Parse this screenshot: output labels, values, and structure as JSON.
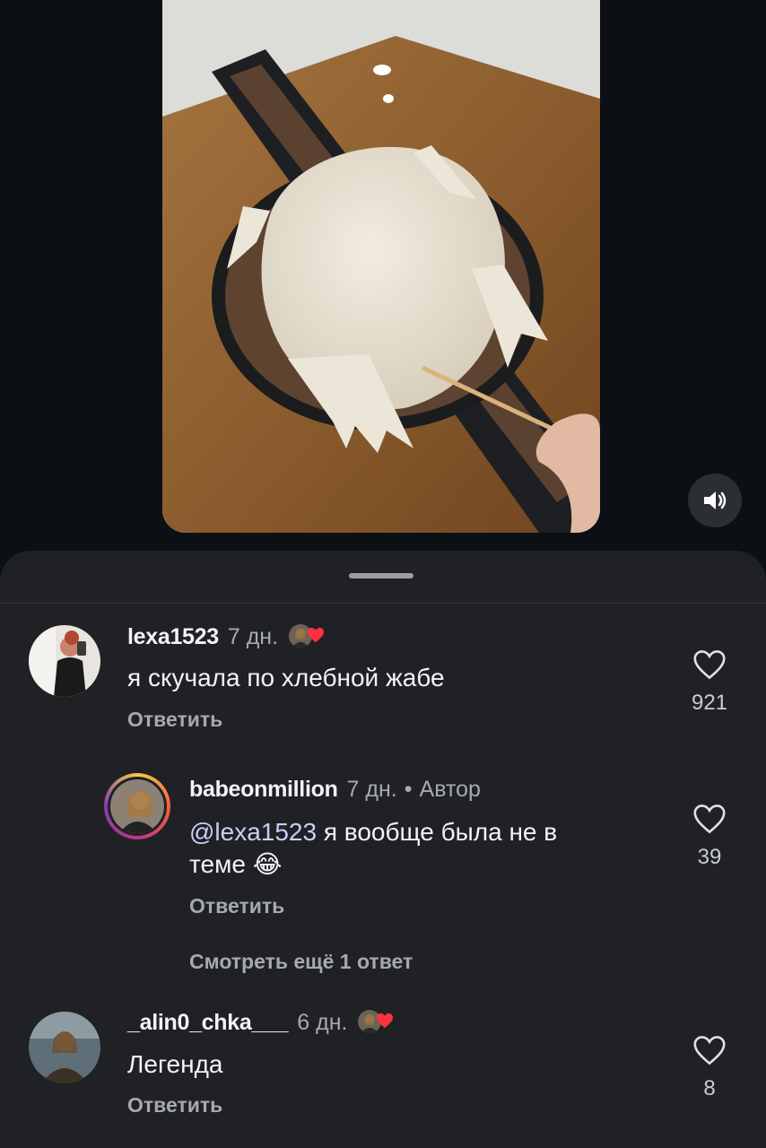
{
  "video": {
    "sound_icon": "speaker-icon"
  },
  "comments": [
    {
      "username": "lexa1523",
      "time": "7 дн.",
      "text": "я скучала по хлебной жабе",
      "reply_label": "Ответить",
      "likes": "921",
      "liked_by_author": true
    },
    {
      "username": "babeonmillion",
      "time": "7 дн.",
      "author_dot": "•",
      "author_label": "Автор",
      "mention": "@lexa1523",
      "text_line1": " я вообще была не в",
      "text_line2": "теме",
      "emoji": "😂",
      "reply_label": "Ответить",
      "likes": "39"
    },
    {
      "username": "_alin0_chka___",
      "time": "6 дн.",
      "text": "Легенда",
      "reply_label": "Ответить",
      "likes": "8",
      "liked_by_author": true
    }
  ],
  "more_replies_label": "Смотреть ещё 1 ответ",
  "colors": {
    "background": "#0c0f14",
    "sheet": "#1f2125",
    "heart_red": "#ff3040",
    "muted_text": "#a6a9af",
    "mention": "#c7cff8"
  }
}
